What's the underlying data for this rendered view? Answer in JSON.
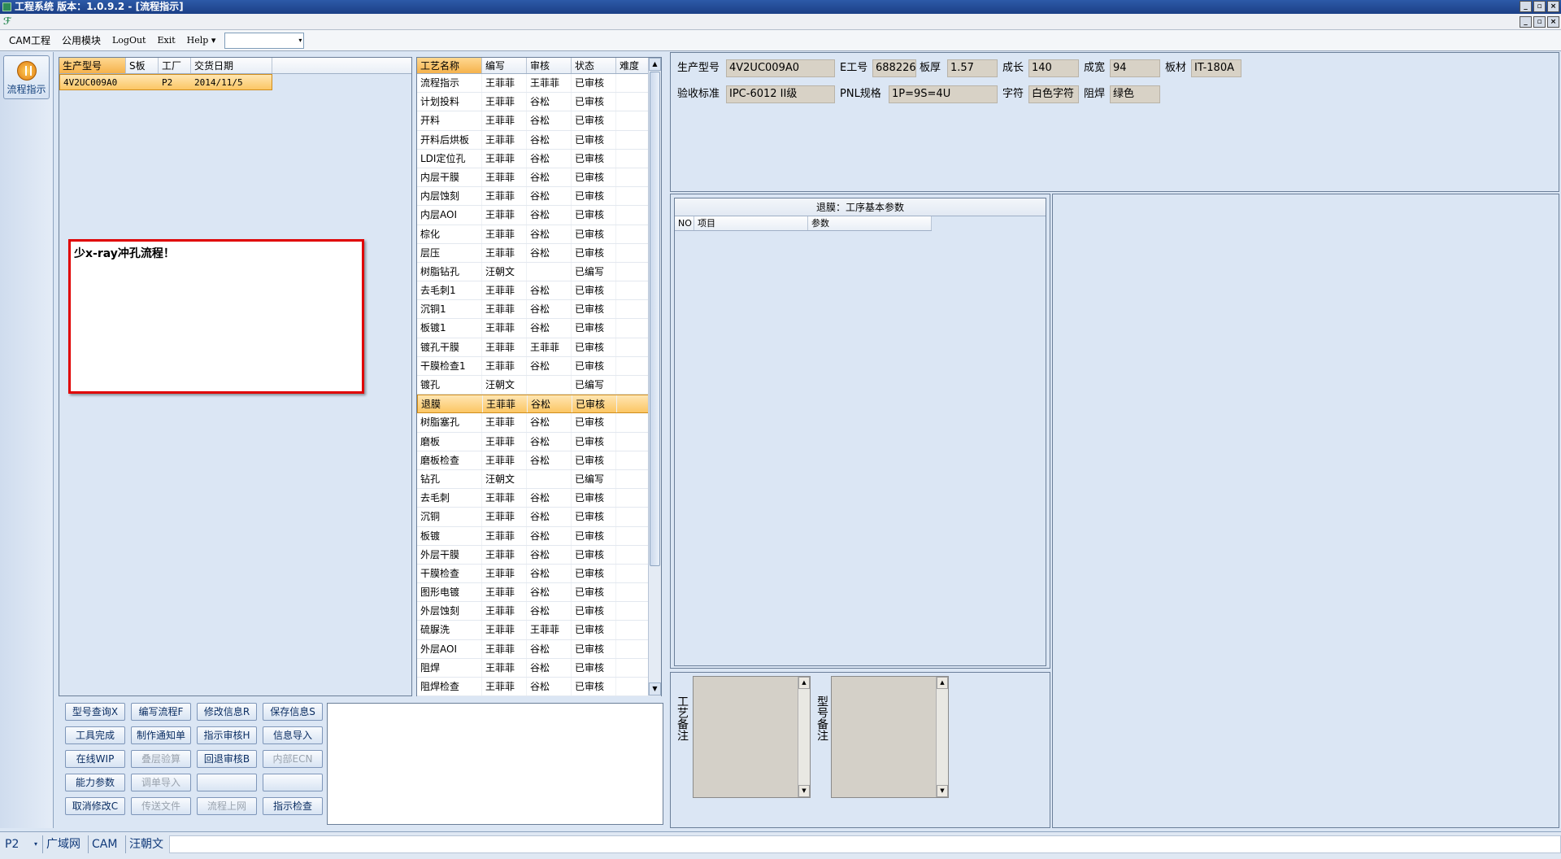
{
  "window": {
    "title": "工程系统    版本：1.0.9.2 - [流程指示]",
    "controls": [
      "_",
      "▫",
      "×"
    ]
  },
  "menu": {
    "items": [
      "CAM工程",
      "公用模块",
      "LogOut",
      "Exit",
      "Help"
    ],
    "help_arrow": "▾",
    "combo_value": ""
  },
  "left_toolbar": {
    "flow_button": "流程指示"
  },
  "product_grid": {
    "columns": [
      "生产型号",
      "S板",
      "工厂",
      "交货日期"
    ],
    "rows": [
      {
        "model": "4V2UC009A0",
        "s_board": "",
        "factory": "P2",
        "delivery": "2014/11/5"
      }
    ]
  },
  "note": {
    "text": "少x-ray冲孔流程！"
  },
  "process_grid": {
    "columns": [
      "工艺名称",
      "编写",
      "审核",
      "状态",
      "难度"
    ],
    "selected_index": 17,
    "rows": [
      [
        "流程指示",
        "王菲菲",
        "王菲菲",
        "已审核",
        ""
      ],
      [
        "计划投料",
        "王菲菲",
        "谷松",
        "已审核",
        ""
      ],
      [
        "开料",
        "王菲菲",
        "谷松",
        "已审核",
        ""
      ],
      [
        "开料后烘板",
        "王菲菲",
        "谷松",
        "已审核",
        ""
      ],
      [
        "LDI定位孔",
        "王菲菲",
        "谷松",
        "已审核",
        ""
      ],
      [
        "内层干膜",
        "王菲菲",
        "谷松",
        "已审核",
        ""
      ],
      [
        "内层蚀刻",
        "王菲菲",
        "谷松",
        "已审核",
        ""
      ],
      [
        "内层AOI",
        "王菲菲",
        "谷松",
        "已审核",
        ""
      ],
      [
        "棕化",
        "王菲菲",
        "谷松",
        "已审核",
        ""
      ],
      [
        "层压",
        "王菲菲",
        "谷松",
        "已审核",
        ""
      ],
      [
        "树脂钻孔",
        "汪朝文",
        "",
        "已编写",
        ""
      ],
      [
        "去毛刺1",
        "王菲菲",
        "谷松",
        "已审核",
        ""
      ],
      [
        "沉铜1",
        "王菲菲",
        "谷松",
        "已审核",
        ""
      ],
      [
        "板镀1",
        "王菲菲",
        "谷松",
        "已审核",
        ""
      ],
      [
        "镀孔干膜",
        "王菲菲",
        "王菲菲",
        "已审核",
        ""
      ],
      [
        "干膜检查1",
        "王菲菲",
        "谷松",
        "已审核",
        ""
      ],
      [
        "镀孔",
        "汪朝文",
        "",
        "已编写",
        ""
      ],
      [
        "退膜",
        "王菲菲",
        "谷松",
        "已审核",
        ""
      ],
      [
        "树脂塞孔",
        "王菲菲",
        "谷松",
        "已审核",
        ""
      ],
      [
        "磨板",
        "王菲菲",
        "谷松",
        "已审核",
        ""
      ],
      [
        "磨板检查",
        "王菲菲",
        "谷松",
        "已审核",
        ""
      ],
      [
        "钻孔",
        "汪朝文",
        "",
        "已编写",
        ""
      ],
      [
        "去毛刺",
        "王菲菲",
        "谷松",
        "已审核",
        ""
      ],
      [
        "沉铜",
        "王菲菲",
        "谷松",
        "已审核",
        ""
      ],
      [
        "板镀",
        "王菲菲",
        "谷松",
        "已审核",
        ""
      ],
      [
        "外层干膜",
        "王菲菲",
        "谷松",
        "已审核",
        ""
      ],
      [
        "干膜检查",
        "王菲菲",
        "谷松",
        "已审核",
        ""
      ],
      [
        "图形电镀",
        "王菲菲",
        "谷松",
        "已审核",
        ""
      ],
      [
        "外层蚀刻",
        "王菲菲",
        "谷松",
        "已审核",
        ""
      ],
      [
        "硫脲洗",
        "王菲菲",
        "王菲菲",
        "已审核",
        ""
      ],
      [
        "外层AOI",
        "王菲菲",
        "谷松",
        "已审核",
        ""
      ],
      [
        "阻焊",
        "王菲菲",
        "谷松",
        "已审核",
        ""
      ],
      [
        "阻焊检查",
        "王菲菲",
        "谷松",
        "已审核",
        ""
      ]
    ]
  },
  "buttons": [
    {
      "id": "model-query",
      "label": "型号查询X",
      "enabled": true
    },
    {
      "id": "write-flow",
      "label": "编写流程F",
      "enabled": true
    },
    {
      "id": "edit-info",
      "label": "修改信息R",
      "enabled": true
    },
    {
      "id": "save-info",
      "label": "保存信息S",
      "enabled": true
    },
    {
      "id": "tool-done",
      "label": "工具完成",
      "enabled": true
    },
    {
      "id": "make-notice",
      "label": "制作通知单",
      "enabled": true
    },
    {
      "id": "instr-review",
      "label": "指示审核H",
      "enabled": true
    },
    {
      "id": "info-import",
      "label": "信息导入",
      "enabled": true
    },
    {
      "id": "online-wip",
      "label": "在线WIP",
      "enabled": true
    },
    {
      "id": "stack-calc",
      "label": "叠层验算",
      "enabled": false
    },
    {
      "id": "rollback-review",
      "label": "回退审核B",
      "enabled": true
    },
    {
      "id": "internal-ecn",
      "label": "内部ECN",
      "enabled": false
    },
    {
      "id": "capability",
      "label": "能力参数",
      "enabled": true
    },
    {
      "id": "order-import",
      "label": "调单导入",
      "enabled": false
    },
    {
      "id": "blank-1",
      "label": "",
      "enabled": false
    },
    {
      "id": "blank-2",
      "label": "",
      "enabled": false
    },
    {
      "id": "cancel-edit",
      "label": "取消修改C",
      "enabled": true
    },
    {
      "id": "send-file",
      "label": "传送文件",
      "enabled": false
    },
    {
      "id": "flow-online",
      "label": "流程上网",
      "enabled": false
    },
    {
      "id": "instr-check",
      "label": "指示检查",
      "enabled": true
    }
  ],
  "info": {
    "model_label": "生产型号",
    "model": "4V2UC009A0",
    "e_no_label": "E工号",
    "e_no": "688226",
    "thickness_label": "板厚",
    "thickness": "1.57",
    "length_label": "成长",
    "length": "140",
    "width_label": "成宽",
    "width": "94",
    "material_label": "板材",
    "material": "IT-180A",
    "standard_label": "验收标准",
    "standard": "IPC-6012 II级",
    "pnl_label": "PNL规格",
    "pnl": "1P=9S=4U",
    "char_label": "字符",
    "char": "白色字符",
    "mask_label": "阻焊",
    "mask": "绿色"
  },
  "param_panel": {
    "title": "退膜：工序基本参数",
    "columns": [
      "NO",
      "项目",
      "参数"
    ]
  },
  "remarks": {
    "process_label": "工艺备注",
    "model_label": "型号备注",
    "up_arrow": "▲",
    "down_arrow": "▼"
  },
  "statusbar": {
    "factory": "P2",
    "combo_arrow": "▾",
    "network": "广域网",
    "module": "CAM",
    "user": "汪朝文"
  }
}
